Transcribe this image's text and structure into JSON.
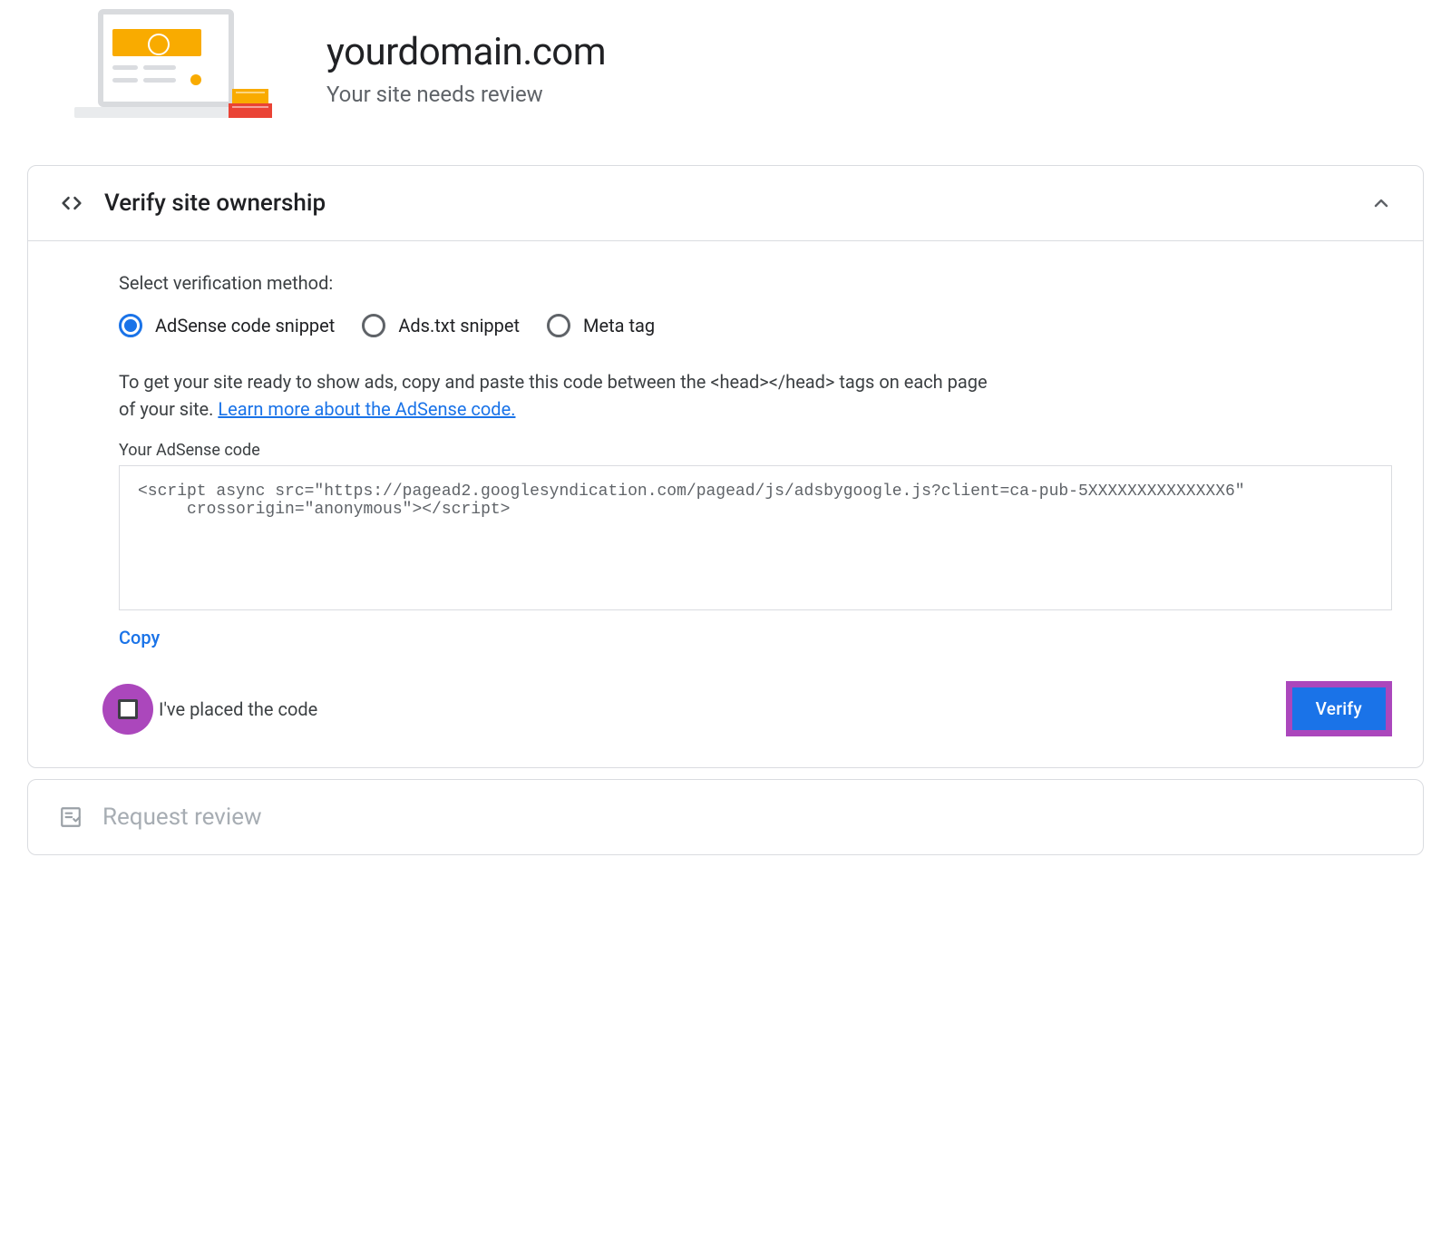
{
  "header": {
    "domain": "yourdomain.com",
    "subtitle": "Your site needs review"
  },
  "verify_card": {
    "title": "Verify site ownership",
    "select_label": "Select verification method:",
    "methods": {
      "adsense": "AdSense code snippet",
      "adstxt": "Ads.txt snippet",
      "meta": "Meta tag"
    },
    "instructions_pre": "To get your site ready to show ads, copy and paste this code between the <head></head> tags on each page of your site. ",
    "learn_more": "Learn more about the AdSense code.",
    "code_label": "Your AdSense code",
    "code_snippet": "<script async src=\"https://pagead2.googlesyndication.com/pagead/js/adsbygoogle.js?client=ca-pub-5XXXXXXXXXXXXXX6\"\n     crossorigin=\"anonymous\"></script>",
    "copy": "Copy",
    "placed_label": "I've placed the code",
    "verify_button": "Verify"
  },
  "review_card": {
    "title": "Request review"
  },
  "colors": {
    "accent_blue": "#1a73e8",
    "highlight_purple": "#ab47bc"
  }
}
